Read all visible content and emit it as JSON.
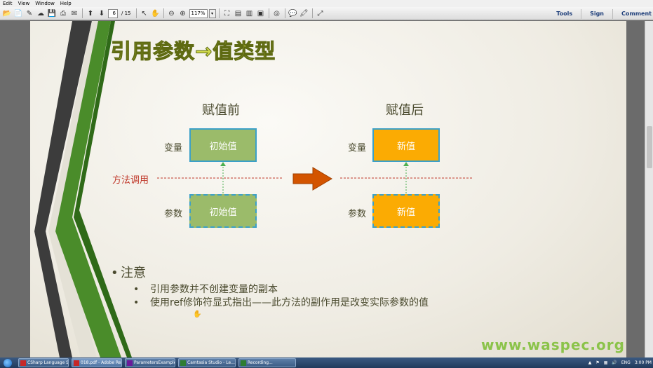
{
  "menubar": {
    "items": [
      "Edit",
      "View",
      "Window",
      "Help"
    ]
  },
  "toolbar": {
    "page_current": "6",
    "page_total": "/ 15",
    "zoom": "117%",
    "right_buttons": {
      "tools": "Tools",
      "sign": "Sign",
      "comment": "Comment"
    }
  },
  "slide": {
    "title": "引用参数→值类型",
    "before_heading": "赋值前",
    "after_heading": "赋值后",
    "row_variable": "变量",
    "row_parameter": "参数",
    "method_call": "方法调用",
    "before_variable_value": "初始值",
    "before_parameter_value": "初始值",
    "after_variable_value": "新值",
    "after_parameter_value": "新值",
    "notes_title": "注意",
    "notes": [
      "引用参数并不创建变量的副本",
      "使用ref修饰符显式指出——此方法的副作用是改变实际参数的值"
    ],
    "watermark": "www.waspec.org",
    "colors": {
      "green_box": "#9bbb6a",
      "orange_box": "#fbab03",
      "method_line": "#c0392b",
      "arrow": "#d35400"
    }
  },
  "taskbar": {
    "tasks": [
      "CSharp Language Sp...",
      "018.pdf - Adobe Rea...",
      "ParametersExample -...",
      "Camtasia Studio - Le...",
      "Recording..."
    ],
    "lang": "ENG",
    "time": "3:00 PM"
  }
}
